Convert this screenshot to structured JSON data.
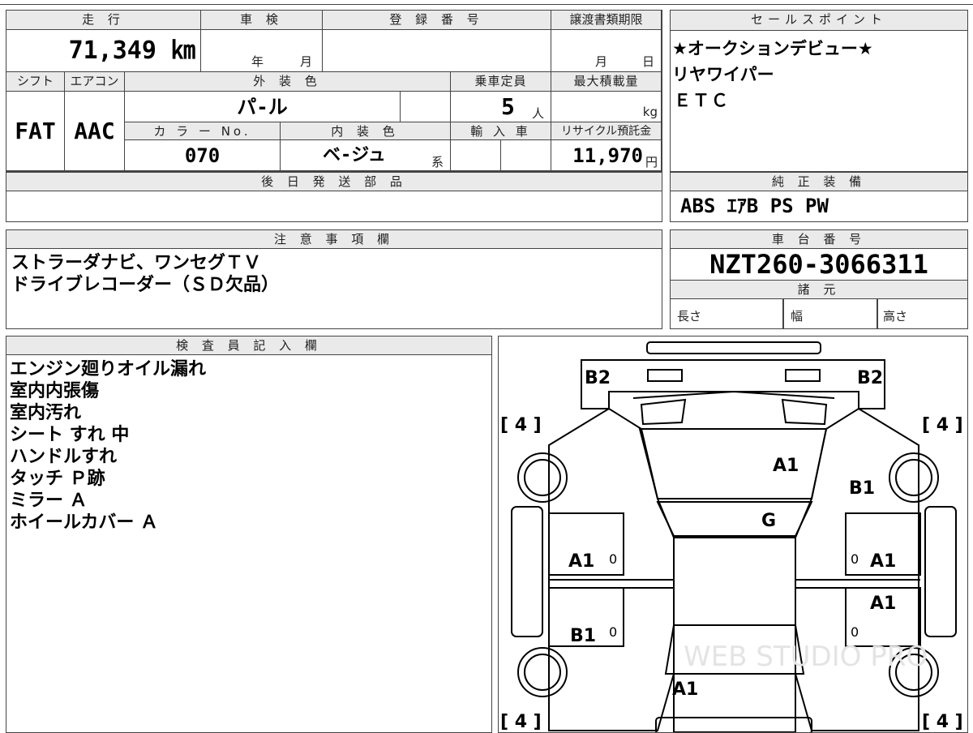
{
  "top": {
    "headers": {
      "mileage": "走 行",
      "inspection": "車 検",
      "registration": "登 録 番 号",
      "transfer_deadline": "譲渡書類期限"
    },
    "mileage": "71,349 ㎞",
    "inspection_year": "年",
    "inspection_month": "月",
    "deadline_month": "月",
    "deadline_day": "日",
    "headers2": {
      "shift": "シフト",
      "aircon": "エアコン",
      "exterior_color": "外 装 色",
      "capacity": "乗車定員",
      "max_load": "最大積載量"
    },
    "shift": "FAT",
    "aircon": "AAC",
    "exterior_color": "パ-ル",
    "capacity": "5",
    "capacity_unit": "人",
    "load_unit": "kg",
    "headers3": {
      "color_no": "カ ラ ー No.",
      "interior_color": "内 装 色",
      "import": "輸 入 車",
      "recycle": "リサイクル預託金"
    },
    "color_no": "070",
    "interior_color": "ベ-ジュ",
    "interior_suffix": "系",
    "recycle_fee": "11,970",
    "yen": "円",
    "later_parts_header": "後 日 発 送 部 品"
  },
  "sales": {
    "header": "セールスポイント",
    "lines": [
      "★オークションデビュー★",
      "リヤワイパー",
      "ＥＴＣ"
    ]
  },
  "equipment": {
    "header": "純 正 装 備",
    "value": "ABS ｴｱB PS PW"
  },
  "notes": {
    "header": "注 意 事 項 欄",
    "lines": [
      "ストラーダナビ、ワンセグＴＶ",
      "ドライブレコーダー（ＳＤ欠品）"
    ]
  },
  "chassis": {
    "header": "車 台 番 号",
    "number": "NZT260-3066311",
    "specs_header": "諸 元",
    "length": "長さ",
    "width": "幅",
    "height": "高さ"
  },
  "inspector": {
    "header": "検 査 員 記 入 欄",
    "lines": [
      "エンジン廻りオイル漏れ",
      "室内内張傷",
      "室内汚れ",
      "シート すれ 中",
      "ハンドルすれ",
      "タッチ Ｐ跡",
      "ミラー Ａ",
      "ホイールカバー Ａ"
    ]
  },
  "diagram": {
    "marks": {
      "rear_left": "B2",
      "rear_right": "B2",
      "roof": "A1",
      "right_quarter": "B1",
      "glass": "G",
      "left_door_rear": "A1",
      "right_door_rear": "A1",
      "right_door_front": "A1",
      "left_door_front": "B1",
      "hood": "A1",
      "zero": "0"
    },
    "tire": "[ 4 ]",
    "watermark": "WEB STUDIO PRO"
  }
}
